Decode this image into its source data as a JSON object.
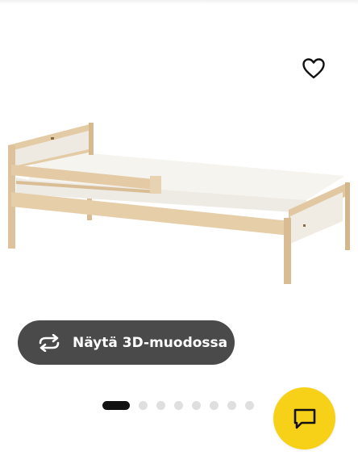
{
  "product": {
    "image_alt": "Kids bed with mattress and guard rail, natural birch frame"
  },
  "favorite": {
    "icon": "heart-outline-icon"
  },
  "view_3d": {
    "label": "Näytä 3D-muodossa",
    "icon": "rotate-arrows-icon"
  },
  "carousel": {
    "dot_count": 8,
    "active_index": 0
  },
  "chat": {
    "icon": "chat-bubble-icon",
    "color": "#f7d117"
  },
  "colors": {
    "button_bg": "#4a4a4a",
    "dot_active": "#111111",
    "dot_inactive": "#dfdfdf"
  }
}
